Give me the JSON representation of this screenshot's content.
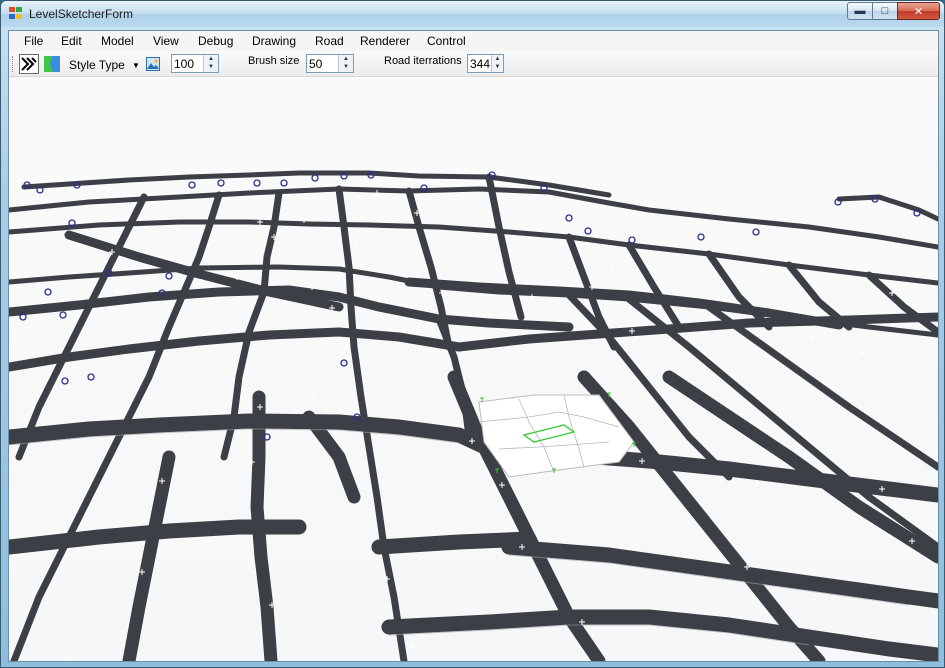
{
  "window": {
    "title": "LevelSketcherForm"
  },
  "menu": [
    "File",
    "Edit",
    "Model",
    "View",
    "Debug",
    "Drawing",
    "Road",
    "Renderer",
    "Control"
  ],
  "toolbar": {
    "style_type_label": "Style Type",
    "zoom_value": "100",
    "brush_size_label": "Brush size",
    "brush_size_value": "50",
    "road_iterations_label": "Road iterrations",
    "road_iterations_value": "344"
  },
  "icons": {
    "app": "app-icon",
    "tool_select": "road-tool-icon",
    "tool_paint": "paint-tool-icon",
    "image": "image-icon"
  },
  "colors": {
    "road": "#3c4046",
    "road_edge": "#9aa2a8",
    "node": "#2a2f8a",
    "marker": "#ffffff",
    "selection": "#35c935",
    "title_bar": "#c4def0",
    "close_button": "#c0392b"
  }
}
